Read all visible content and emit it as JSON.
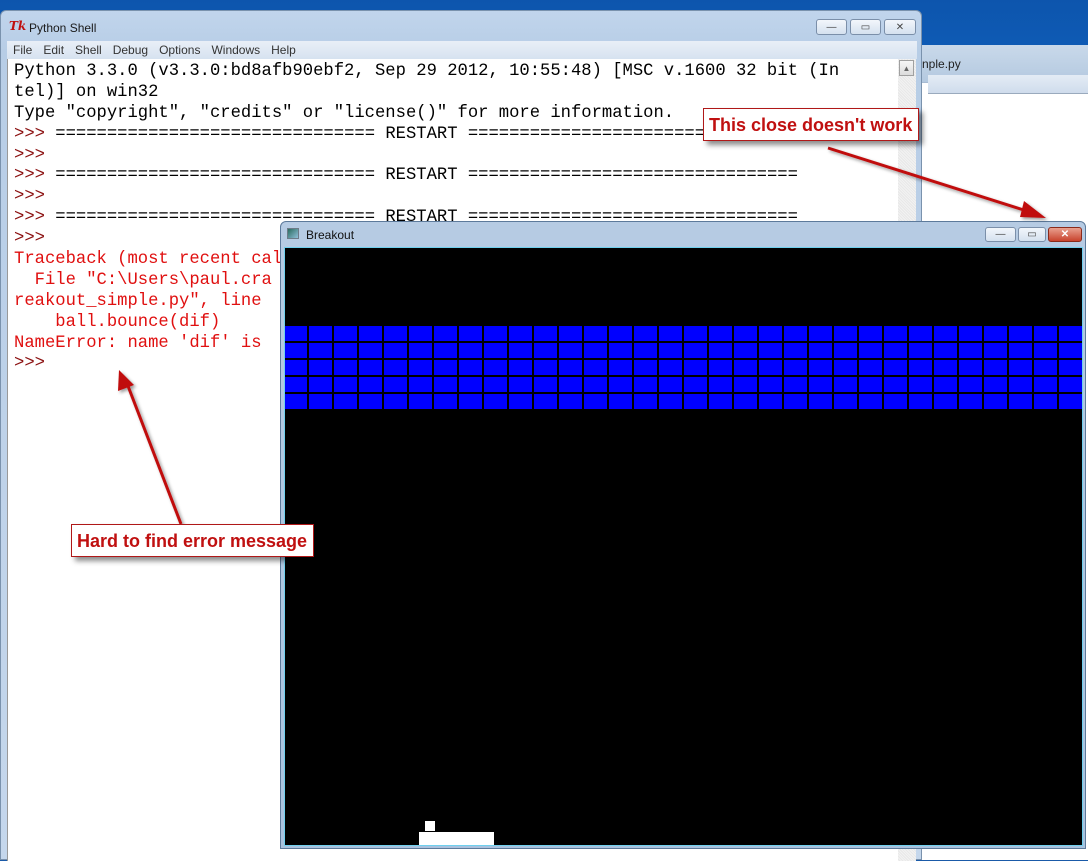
{
  "shell_window": {
    "icon": "Tk",
    "title": "Python Shell",
    "controls": {
      "minimize": "—",
      "maximize": "▭",
      "close": "✕"
    },
    "menu": [
      "File",
      "Edit",
      "Shell",
      "Debug",
      "Options",
      "Windows",
      "Help"
    ],
    "lines": [
      {
        "type": "out",
        "text": "Python 3.3.0 (v3.3.0:bd8afb90ebf2, Sep 29 2012, 10:55:48) [MSC v.1600 32 bit (In"
      },
      {
        "type": "out",
        "text": "tel)] on win32"
      },
      {
        "type": "out",
        "text": "Type \"copyright\", \"credits\" or \"license()\" for more information."
      },
      {
        "type": "prompt",
        "prompt": ">>> ",
        "text": "=============================== RESTART ================================"
      },
      {
        "type": "prompt",
        "prompt": ">>> ",
        "text": ""
      },
      {
        "type": "prompt",
        "prompt": ">>> ",
        "text": "=============================== RESTART ================================"
      },
      {
        "type": "prompt",
        "prompt": ">>> ",
        "text": ""
      },
      {
        "type": "prompt",
        "prompt": ">>> ",
        "text": "=============================== RESTART ================================"
      },
      {
        "type": "prompt",
        "prompt": ">>> ",
        "text": ""
      },
      {
        "type": "err",
        "text": "Traceback (most recent call last):"
      },
      {
        "type": "err",
        "text": "  File \"C:\\Users\\paul.cra"
      },
      {
        "type": "err",
        "text": "reakout_simple.py\", line"
      },
      {
        "type": "err",
        "text": "    ball.bounce(dif)"
      },
      {
        "type": "err",
        "text": "NameError: name 'dif' is"
      },
      {
        "type": "prompt",
        "prompt": ">>> ",
        "text": ""
      }
    ]
  },
  "background_window": {
    "title_fragment": "nple.py"
  },
  "breakout_window": {
    "title": "Breakout",
    "controls": {
      "minimize": "—",
      "maximize": "▭",
      "close": "✕"
    },
    "game": {
      "brick_rows": 5,
      "brick_columns": 32,
      "brick_color": "#0000ff",
      "background_color": "#000000",
      "ball_color": "#ffffff",
      "paddle_color": "#ffffff"
    }
  },
  "annotations": [
    {
      "text": "This close doesn't work",
      "target": "breakout-close-button"
    },
    {
      "text": "Hard to find error message",
      "target": "shell-error-output"
    }
  ],
  "colors": {
    "annotation_red": "#c01010",
    "error_text": "#e01010",
    "prompt": "#8b1010"
  }
}
